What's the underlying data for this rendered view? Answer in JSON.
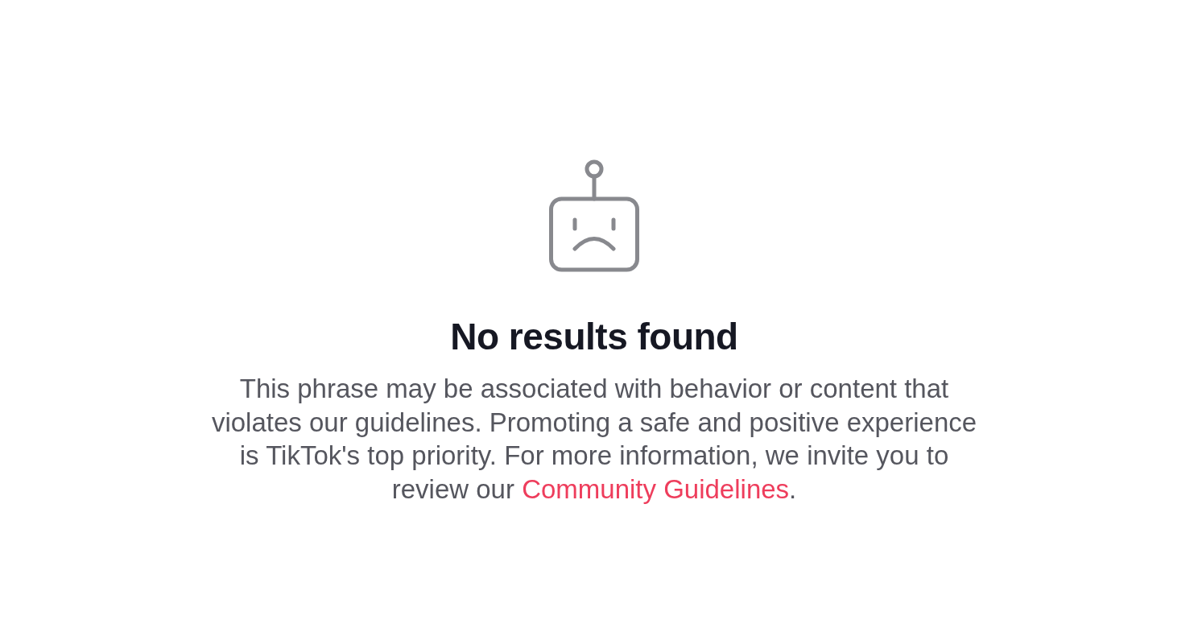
{
  "empty_state": {
    "title": "No results found",
    "message": {
      "text": "This phrase may be associated with behavior or content that violates our guidelines. Promoting a safe and positive experience is TikTok's top priority. For more information, we invite you to review our ",
      "link": "Community Guidelines",
      "text_after": "."
    }
  }
}
